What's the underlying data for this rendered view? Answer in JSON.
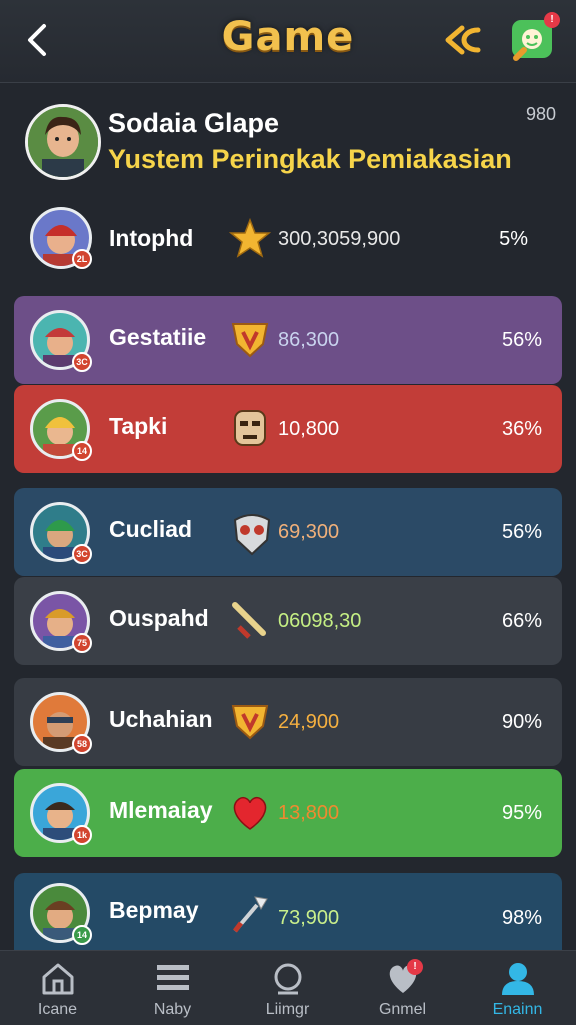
{
  "header": {
    "title": "Game",
    "notification_count": "!"
  },
  "profile": {
    "name": "Sodaia Glape",
    "subtitle": "Yustem Peringkak Pemiakasian",
    "score": "980"
  },
  "leaderboard": [
    {
      "name": "Intophd",
      "level": "2L",
      "icon": "star-icon",
      "points": "300,3059,900",
      "percent": "5%",
      "bg": "#454a52",
      "points_color": "#e8e8e8"
    },
    {
      "name": "Gestatiie",
      "level": "3C",
      "icon": "shield-icon",
      "points": "86,300",
      "percent": "56%",
      "bg": "#6d4f88",
      "points_color": "#c9d3ee"
    },
    {
      "name": "Tapki",
      "level": "14",
      "icon": "mask-icon",
      "points": "10,800",
      "percent": "36%",
      "bg": "#c23d38",
      "points_color": "#ffffff"
    },
    {
      "name": "Cucliad",
      "level": "3C",
      "icon": "helmet-icon",
      "points": "69,300",
      "percent": "56%",
      "bg": "#2b4a66",
      "points_color": "#f0b07a"
    },
    {
      "name": "Ouspahd",
      "level": "75",
      "icon": "sword-icon",
      "points": "06098,30",
      "percent": "66%",
      "bg": "#3a3f47",
      "points_color": "#c5ef84"
    },
    {
      "name": "Uchahian",
      "level": "58",
      "icon": "shield-icon",
      "points": "24,900",
      "percent": "90%",
      "bg": "#373c44",
      "points_color": "#f5b040"
    },
    {
      "name": "Mlemaiay",
      "level": "1k",
      "icon": "heart-icon",
      "points": "13,800",
      "percent": "95%",
      "bg": "#4cae4a",
      "points_color": "#f08a30"
    },
    {
      "name": "Bepmay",
      "level": "14",
      "icon": "spear-icon",
      "points": "73,900",
      "percent": "98%",
      "bg": "#244a66",
      "points_color": "#c9ef8b"
    }
  ],
  "nav": [
    {
      "label": "Icane",
      "icon": "home-icon"
    },
    {
      "label": "Naby",
      "icon": "list-icon"
    },
    {
      "label": "Liimgr",
      "icon": "profile-icon"
    },
    {
      "label": "Gnmel",
      "icon": "heart-icon"
    },
    {
      "label": "Enainn",
      "icon": "user-icon"
    }
  ],
  "nav_badge": "!"
}
